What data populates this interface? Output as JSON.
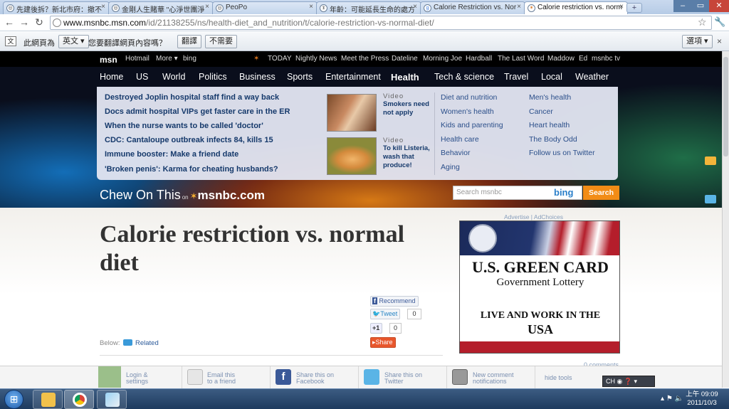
{
  "browser": {
    "tabs": [
      {
        "label": "先建後拆？新北市府：撤不",
        "icon": "globe"
      },
      {
        "label": "金剛人生賭華 \"心淨世團淨",
        "icon": "globe"
      },
      {
        "label": "PeoPo",
        "icon": "globe"
      },
      {
        "label": "年齡：可能延長生命的處方",
        "icon": "nyt"
      },
      {
        "label": "Calorie Restriction vs. Nor",
        "icon": "google"
      },
      {
        "label": "Calorie restriction vs. norm",
        "icon": "msnbc"
      }
    ],
    "new_tab": "+",
    "window_controls": [
      "–",
      "▭",
      "✕"
    ],
    "url_host": "www.msnbc.msn.com",
    "url_path": "/id/21138255/ns/health-diet_and_nutrition/t/calorie-restriction-vs-normal-diet/"
  },
  "translate_bar": {
    "prefix": "此網頁為",
    "language": "英文",
    "question": "您要翻譯網頁內容嗎？",
    "translate_btn": "翻譯",
    "no_btn": "不需要",
    "options_btn": "選項"
  },
  "msn_bar": {
    "logo": "msn",
    "links_left": [
      "Hotmail",
      "More",
      "bing"
    ],
    "links_right": [
      "TODAY",
      "Nightly News",
      "Meet the Press",
      "Dateline",
      "Morning Joe",
      "Hardball",
      "The Last Word",
      "Maddow",
      "Ed",
      "msnbc tv"
    ]
  },
  "main_nav": [
    "Home",
    "US",
    "World",
    "Politics",
    "Business",
    "Sports",
    "Entertainment",
    "Health",
    "Tech & science",
    "Travel",
    "Local",
    "Weather"
  ],
  "main_nav_active": "Health",
  "dropdown": {
    "headlines": [
      "Destroyed Joplin hospital staff find a way back",
      "Docs admit hospital VIPs get faster care in the ER",
      "When the nurse wants to be called 'doctor'",
      "CDC: Cantaloupe outbreak infects 84, kills 15",
      "Immune booster: Make a friend date",
      "'Broken penis': Karma for cheating husbands?"
    ],
    "videos": [
      {
        "label": "Video",
        "title": "Smokers need not apply"
      },
      {
        "label": "Video",
        "title": "To kill Listeria, wash that produce!"
      }
    ],
    "categories_col1": [
      "Diet and nutrition",
      "Women's health",
      "Kids and parenting",
      "Health care",
      "Behavior",
      "Aging"
    ],
    "categories_col2": [
      "Men's health",
      "Cancer",
      "Heart health",
      "The Body Odd",
      "Follow us on Twitter"
    ]
  },
  "section_brand": {
    "title": "Chew On This",
    "on": "on",
    "brand": "msnbc.com"
  },
  "search": {
    "placeholder": "Search msnbc",
    "bing": "bing",
    "button": "Search"
  },
  "article": {
    "title": "Calorie restriction vs. normal diet",
    "social": {
      "recommend": "Recommend",
      "tweet": "Tweet",
      "tweet_count": "0",
      "plusone": "+1",
      "plusone_count": "0",
      "share": "Share"
    },
    "below_label": "Below:",
    "related_label": "Related"
  },
  "ad": {
    "header": "Advertise | AdChoices",
    "line1": "U.S. GREEN CARD",
    "line2": "Government Lottery",
    "line3": "LIVE AND WORK IN THE",
    "line4": "USA"
  },
  "comments": "0 comments",
  "sharebar": [
    {
      "l1": "Login &",
      "l2": "settings"
    },
    {
      "l1": "Email this",
      "l2": "to a friend"
    },
    {
      "l1": "Share this on",
      "l2": "Facebook"
    },
    {
      "l1": "Share this on",
      "l2": "Twitter"
    },
    {
      "l1": "New comment",
      "l2": "notifications"
    }
  ],
  "hide_tools": "hide tools",
  "ime": "CH",
  "taskbar": {
    "time": "上午 09:09",
    "date": "2011/10/3"
  },
  "colors": {
    "accent_orange": "#f28c16",
    "link_blue": "#15396b",
    "bing_blue": "#2a7fc9"
  }
}
